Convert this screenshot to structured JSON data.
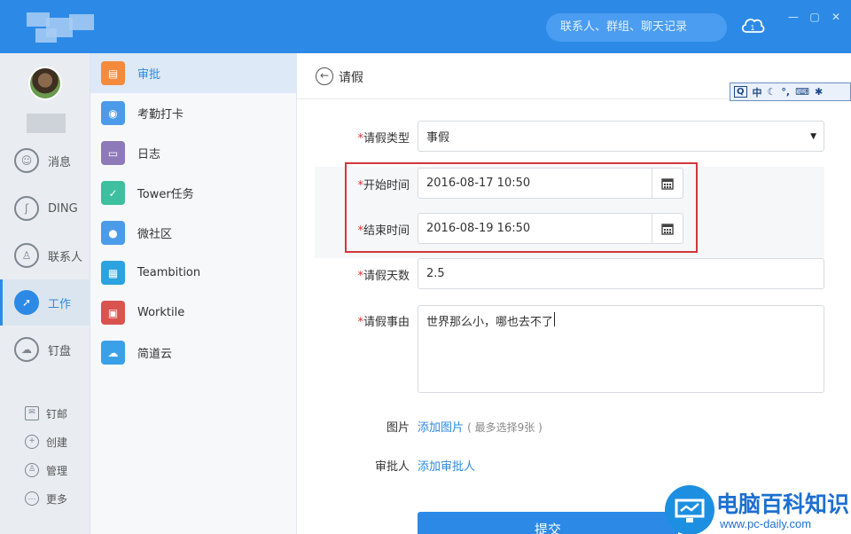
{
  "header": {
    "search_placeholder": "联系人、群组、聊天记录",
    "cloud_icon": "cloud-download-icon"
  },
  "rail": {
    "items": [
      {
        "label": "消息",
        "icon": "smile-icon"
      },
      {
        "label": "DING",
        "icon": "ding-icon"
      },
      {
        "label": "联系人",
        "icon": "contacts-icon"
      },
      {
        "label": "工作",
        "icon": "compass-icon",
        "active": true
      },
      {
        "label": "钉盘",
        "icon": "cloud-disk-icon"
      }
    ],
    "small_items": [
      {
        "label": "钉邮",
        "icon": "mail-icon"
      },
      {
        "label": "创建",
        "icon": "plus-icon"
      },
      {
        "label": "管理",
        "icon": "admin-icon"
      },
      {
        "label": "更多",
        "icon": "more-icon"
      }
    ]
  },
  "apps": [
    {
      "label": "审批",
      "icon": "approval-icon",
      "color": "#f58a3c",
      "active": true
    },
    {
      "label": "考勤打卡",
      "icon": "location-icon",
      "color": "#4c9be8"
    },
    {
      "label": "日志",
      "icon": "log-icon",
      "color": "#8e7ab8"
    },
    {
      "label": "Tower任务",
      "icon": "check-icon",
      "color": "#3ebf9f"
    },
    {
      "label": "微社区",
      "icon": "community-icon",
      "color": "#4c9be8"
    },
    {
      "label": "Teambition",
      "icon": "teambition-icon",
      "color": "#2aa3e0"
    },
    {
      "label": "Worktile",
      "icon": "worktile-icon",
      "color": "#d9534f"
    },
    {
      "label": "简道云",
      "icon": "cloud-icon",
      "color": "#3aa1e8"
    }
  ],
  "form": {
    "title": "请假",
    "ime": {
      "label": "中"
    },
    "leave_type": {
      "label": "请假类型",
      "value": "事假"
    },
    "start_time": {
      "label": "开始时间",
      "value": "2016-08-17 10:50"
    },
    "end_time": {
      "label": "结束时间",
      "value": "2016-08-19 16:50"
    },
    "days": {
      "label": "请假天数",
      "value": "2.5"
    },
    "reason": {
      "label": "请假事由",
      "value": "世界那么小，哪也去不了"
    },
    "image": {
      "label": "图片",
      "link": "添加图片",
      "hint": "( 最多选择9张 )"
    },
    "approver": {
      "label": "审批人",
      "link": "添加审批人"
    },
    "submit_label": "提交"
  },
  "watermark": {
    "text": "电脑百科知识",
    "url": "www.pc-daily.com"
  }
}
